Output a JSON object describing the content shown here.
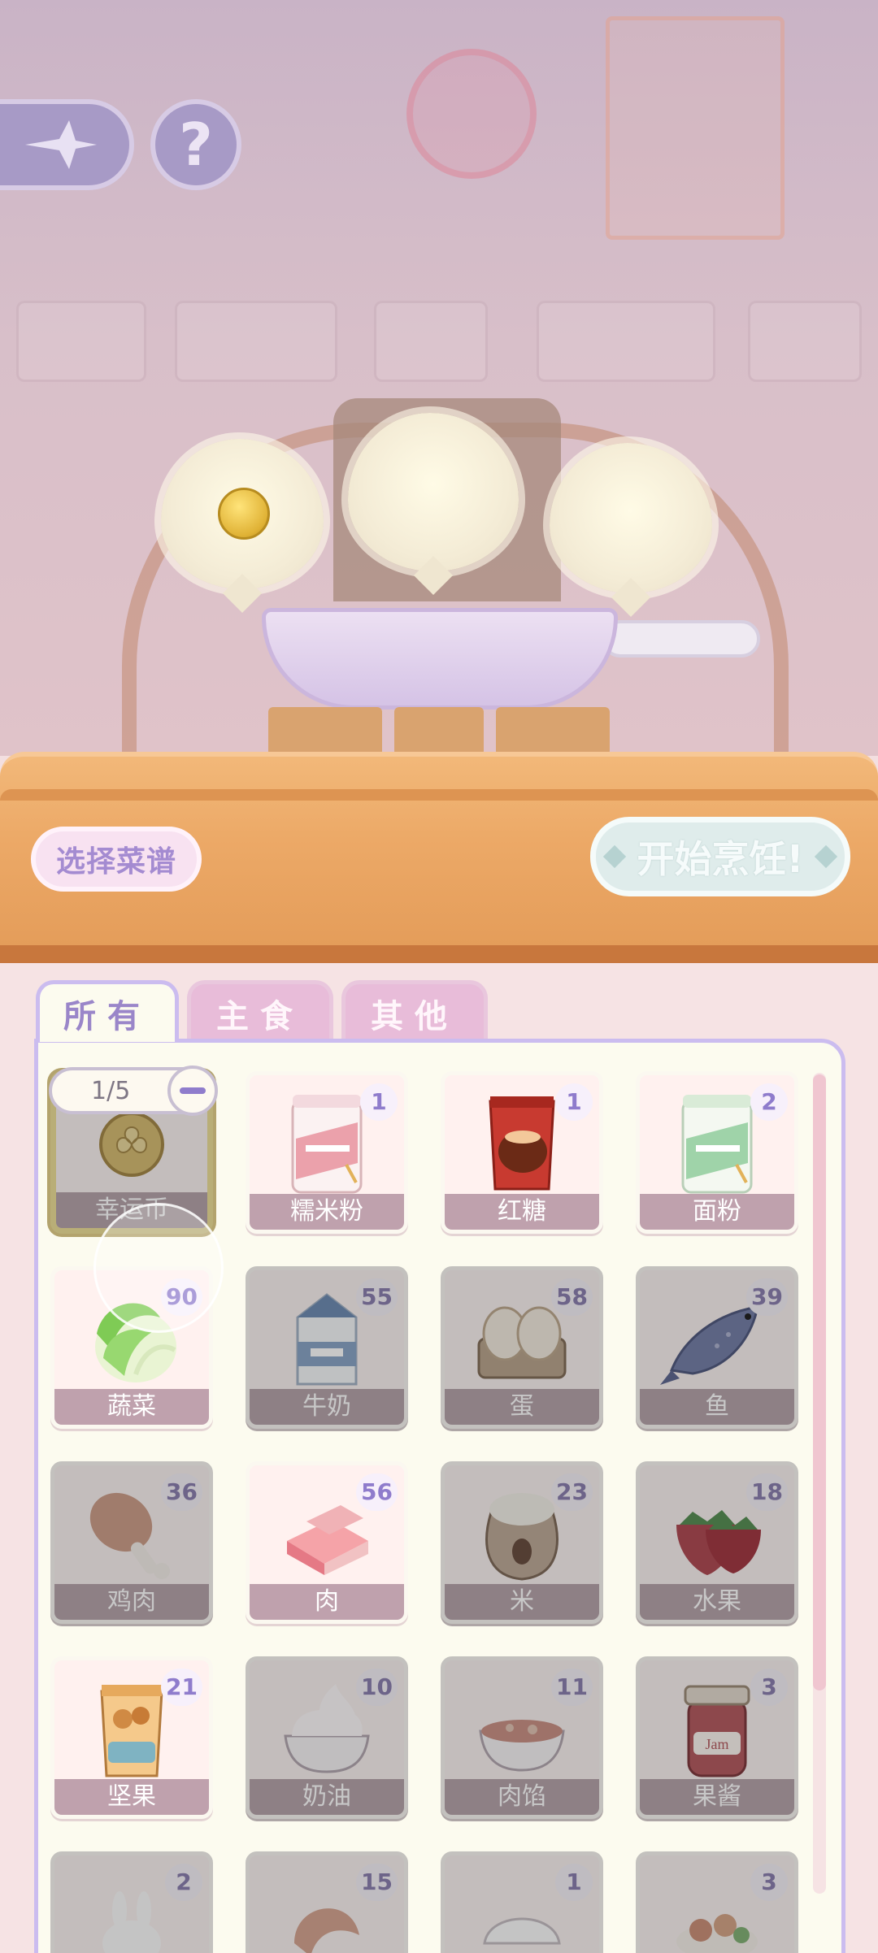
{
  "scene": {
    "back_icon": "diamond-arrow-icon",
    "help_icon": "question-mark-icon",
    "help_glyph": "?",
    "bubble_contents": [
      "lucky-coin",
      "",
      ""
    ]
  },
  "buttons": {
    "recipe_label": "选择菜谱",
    "cook_label": "开始烹饪!"
  },
  "tabs": [
    {
      "label": "所有",
      "active": true
    },
    {
      "label": "主食",
      "active": false
    },
    {
      "label": "其他",
      "active": false
    }
  ],
  "selection": {
    "counter": "1/5"
  },
  "colors": {
    "accent_purple": "#9a86c9",
    "selected_border": "#f9e06b",
    "counter_wood": "#eca967"
  },
  "items": [
    {
      "name": "幸运币",
      "count": "",
      "selected": true,
      "dim": true,
      "icon": "coin-icon"
    },
    {
      "name": "糯米粉",
      "count": "1",
      "selected": false,
      "dim": false,
      "icon": "flour-bag-pink-icon"
    },
    {
      "name": "红糖",
      "count": "1",
      "selected": false,
      "dim": false,
      "icon": "sugar-bag-icon"
    },
    {
      "name": "面粉",
      "count": "2",
      "selected": false,
      "dim": false,
      "icon": "flour-bag-green-icon"
    },
    {
      "name": "蔬菜",
      "count": "90",
      "selected": false,
      "dim": false,
      "icon": "cabbage-icon"
    },
    {
      "name": "牛奶",
      "count": "55",
      "selected": false,
      "dim": true,
      "icon": "milk-carton-icon"
    },
    {
      "name": "蛋",
      "count": "58",
      "selected": false,
      "dim": true,
      "icon": "eggs-icon"
    },
    {
      "name": "鱼",
      "count": "39",
      "selected": false,
      "dim": true,
      "icon": "fish-icon"
    },
    {
      "name": "鸡肉",
      "count": "36",
      "selected": false,
      "dim": true,
      "icon": "drumstick-icon"
    },
    {
      "name": "肉",
      "count": "56",
      "selected": false,
      "dim": false,
      "icon": "meat-icon"
    },
    {
      "name": "米",
      "count": "23",
      "selected": false,
      "dim": true,
      "icon": "rice-sack-icon"
    },
    {
      "name": "水果",
      "count": "18",
      "selected": false,
      "dim": true,
      "icon": "strawberry-icon"
    },
    {
      "name": "坚果",
      "count": "21",
      "selected": false,
      "dim": false,
      "icon": "nuts-bag-icon"
    },
    {
      "name": "奶油",
      "count": "10",
      "selected": false,
      "dim": true,
      "icon": "cream-bowl-icon"
    },
    {
      "name": "肉馅",
      "count": "11",
      "selected": false,
      "dim": true,
      "icon": "mince-bowl-icon"
    },
    {
      "name": "果酱",
      "count": "3",
      "selected": false,
      "dim": true,
      "icon": "jam-jar-icon"
    },
    {
      "name": "",
      "count": "2",
      "selected": false,
      "dim": true,
      "icon": "bunny-icon"
    },
    {
      "name": "",
      "count": "15",
      "selected": false,
      "dim": true,
      "icon": "shrimp-icon"
    },
    {
      "name": "",
      "count": "1",
      "selected": false,
      "dim": true,
      "icon": "dumpling-icon"
    },
    {
      "name": "",
      "count": "3",
      "selected": false,
      "dim": true,
      "icon": "salad-icon"
    }
  ]
}
